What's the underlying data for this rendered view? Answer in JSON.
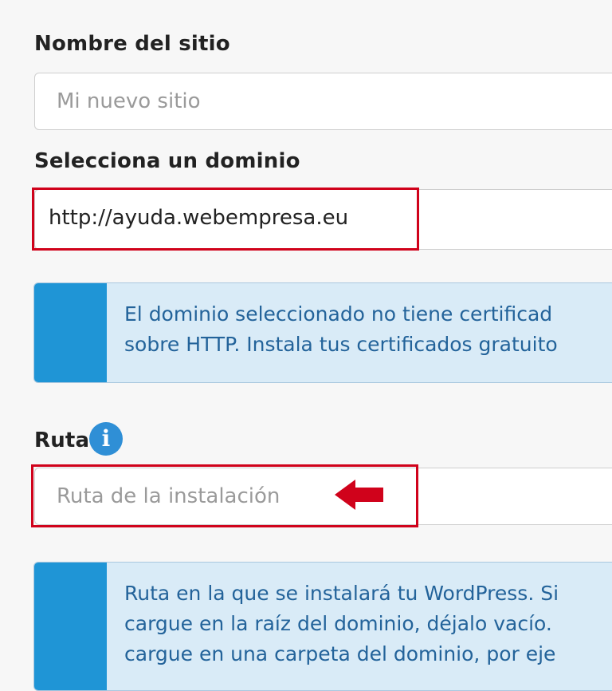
{
  "site_name": {
    "label": "Nombre del sitio",
    "placeholder": "Mi nuevo sitio"
  },
  "domain": {
    "label": "Selecciona un dominio",
    "value": "http://ayuda.webempresa.eu"
  },
  "domain_alert": {
    "line1": "El dominio seleccionado no tiene certificad",
    "line2": "sobre HTTP. Instala tus certificados gratuito"
  },
  "path": {
    "label": "Ruta",
    "placeholder": "Ruta de la instalación",
    "info_icon": "info-icon"
  },
  "path_alert": {
    "line1": "Ruta en la que se instalará tu WordPress. Si",
    "line2": "cargue en la raíz del dominio, déjalo vacío.",
    "line3": "cargue en una carpeta del dominio, por eje"
  },
  "colors": {
    "highlight": "#d0021b",
    "alert_bar": "#1f95d6",
    "alert_bg": "#d9ebf7",
    "alert_text": "#23639a"
  }
}
